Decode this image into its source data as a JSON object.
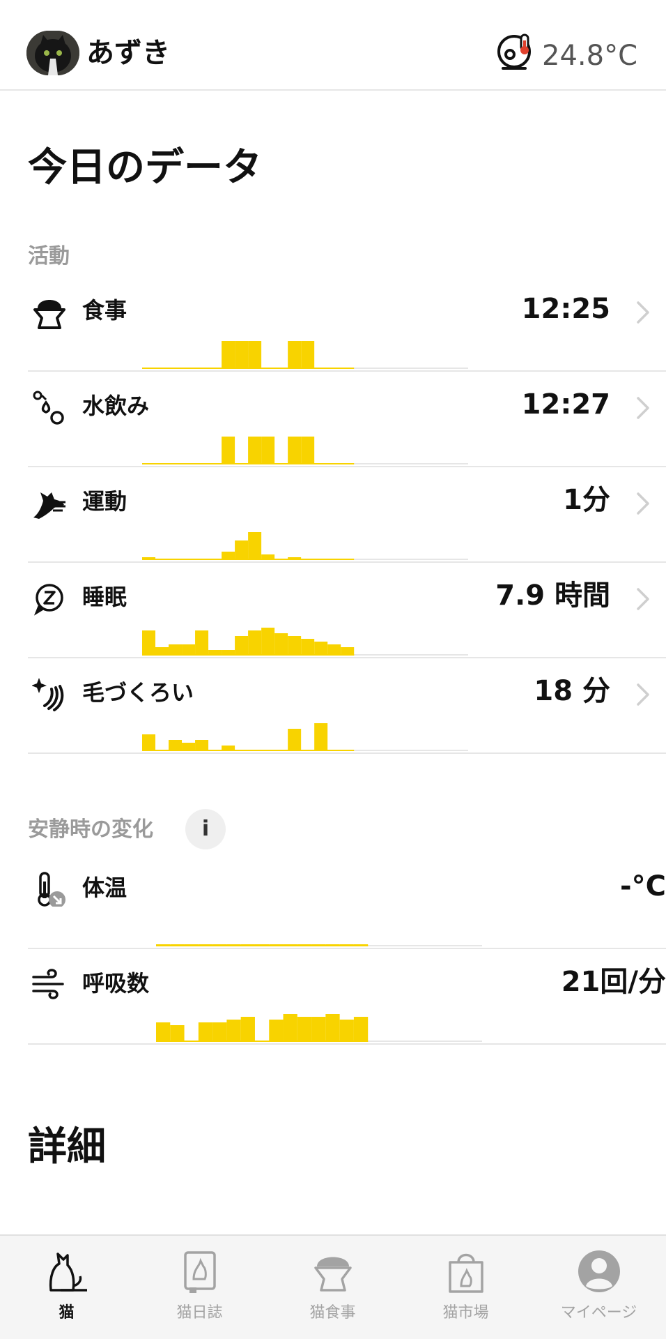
{
  "header": {
    "cat_name": "あずき",
    "device_temp": "24.8°C",
    "avatar_icon": "cat-avatar",
    "device_icon": "camera-thermometer-icon"
  },
  "page_title": "今日のデータ",
  "sections": {
    "activity_label": "活動",
    "rest_label": "安静時の変化",
    "info_label": "i",
    "detail_title": "詳細"
  },
  "colors": {
    "accent": "#f8d300",
    "divider": "#e6e6e6",
    "muted": "#9a9a9a"
  },
  "activity_rows": [
    {
      "key": "meal",
      "label": "食事",
      "value": "12:25",
      "icon": "food-bowl-icon",
      "bars": [
        0,
        0,
        0,
        0,
        0,
        0,
        1,
        1,
        1,
        0,
        0,
        1,
        1,
        0,
        0,
        0
      ]
    },
    {
      "key": "drink",
      "label": "水飲み",
      "value": "12:27",
      "icon": "water-drops-icon",
      "bars": [
        0,
        0,
        0,
        0,
        0,
        0,
        1,
        0,
        1,
        1,
        0,
        1,
        1,
        0,
        0,
        0
      ]
    },
    {
      "key": "exercise",
      "label": "運動",
      "value": "1分",
      "icon": "running-cat-icon",
      "bars": [
        0.1,
        0,
        0,
        0,
        0,
        0,
        0.3,
        0.7,
        1,
        0.2,
        0,
        0.1,
        0,
        0,
        0,
        0
      ]
    },
    {
      "key": "sleep",
      "label": "睡眠",
      "value": "7.9 時間",
      "icon": "sleep-z-icon",
      "bars": [
        0.9,
        0.3,
        0.4,
        0.4,
        0.9,
        0.2,
        0.2,
        0.7,
        0.9,
        1,
        0.8,
        0.7,
        0.6,
        0.5,
        0.4,
        0.3
      ]
    },
    {
      "key": "grooming",
      "label": "毛づくろい",
      "value": "18 分",
      "icon": "sparkle-lick-icon",
      "bars": [
        0.6,
        0,
        0.4,
        0.3,
        0.4,
        0,
        0.2,
        0,
        0,
        0,
        0,
        0.8,
        0,
        1,
        0,
        0
      ]
    }
  ],
  "rest_rows": [
    {
      "key": "body_temp",
      "label": "体温",
      "value": "-°C",
      "icon": "thermometer-down-icon",
      "bars": [
        0.05,
        0.05,
        0.05,
        0.05,
        0.05,
        0.05,
        0.05,
        0.05,
        0.05,
        0.05,
        0.05,
        0.05,
        0.05,
        0.05,
        0.05
      ]
    },
    {
      "key": "respiration",
      "label": "呼吸数",
      "value": "21回/分",
      "icon": "breath-wind-icon",
      "bars": [
        0.7,
        0.6,
        0,
        0.7,
        0.7,
        0.8,
        0.9,
        0,
        0.8,
        1,
        0.9,
        0.9,
        1,
        0.8,
        0.9
      ]
    }
  ],
  "tabs": [
    {
      "label": "猫",
      "icon": "cat-icon",
      "active": true
    },
    {
      "label": "猫日誌",
      "icon": "diary-icon",
      "active": false
    },
    {
      "label": "猫食事",
      "icon": "food-bowl-icon",
      "active": false
    },
    {
      "label": "猫市場",
      "icon": "shopping-bag-icon",
      "active": false
    },
    {
      "label": "マイページ",
      "icon": "person-icon",
      "active": false
    }
  ]
}
